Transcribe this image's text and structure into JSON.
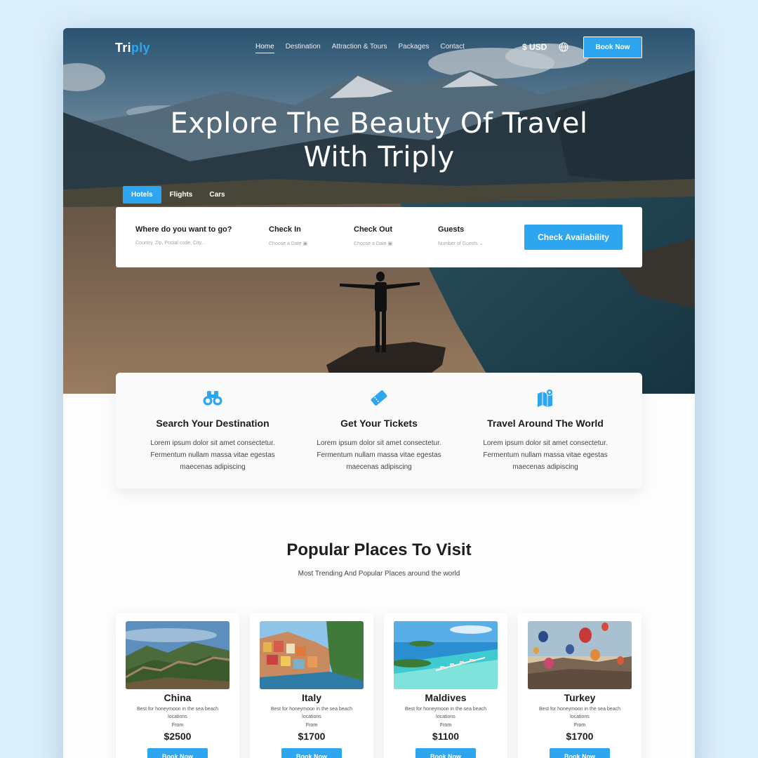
{
  "brand": {
    "logo_main": "Tri",
    "logo_accent": "ply",
    "accent_color": "#2ea6ef"
  },
  "nav": {
    "links": [
      "Home",
      "Destination",
      "Attraction & Tours",
      "Packages",
      "Contact"
    ],
    "currency": "$ USD",
    "book_now": "Book Now",
    "icons": {
      "language": "globe-icon"
    }
  },
  "hero": {
    "title_line1": "Explore The Beauty Of Travel",
    "title_line2": "With Triply"
  },
  "search": {
    "tabs": [
      "Hotels",
      "Flights",
      "Cars"
    ],
    "active_tab": "Hotels",
    "fields": [
      {
        "label": "Where do you want to go?",
        "placeholder": "Country, Zip, Postal code, City..."
      },
      {
        "label": "Check In",
        "placeholder": "Choose a Date",
        "icon": "calendar-icon"
      },
      {
        "label": "Check Out",
        "placeholder": "Choose a Date",
        "icon": "calendar-icon"
      },
      {
        "label": "Guests",
        "placeholder": "Number of Guests",
        "icon": "chevron-down-icon"
      }
    ],
    "button": "Check Availability"
  },
  "features": [
    {
      "icon": "binoculars-icon",
      "title": "Search Your Destination",
      "text": "Lorem ipsum dolor sit amet consectetur. Fermentum nullam massa vitae egestas maecenas adipiscing"
    },
    {
      "icon": "ticket-icon",
      "title": "Get Your Tickets",
      "text": "Lorem ipsum dolor sit amet consectetur. Fermentum nullam massa vitae egestas maecenas adipiscing"
    },
    {
      "icon": "map-pin-icon",
      "title": "Travel Around The World",
      "text": "Lorem ipsum dolor sit amet consectetur. Fermentum nullam massa vitae egestas maecenas adipiscing"
    }
  ],
  "popular": {
    "title": "Popular Places To Visit",
    "subtitle": "Most Trending And Popular Places around the world",
    "places": [
      {
        "name": "China",
        "desc": "Best for honeymoon in the sea beach locations",
        "from": "From",
        "price": "$2500",
        "button": "Book Now"
      },
      {
        "name": "Italy",
        "desc": "Best for honeymoon in the sea beach locations",
        "from": "From",
        "price": "$1700",
        "button": "Book Now"
      },
      {
        "name": "Maldives",
        "desc": "Best for honeymoon in the sea beach locations",
        "from": "From",
        "price": "$1100",
        "button": "Book Now"
      },
      {
        "name": "Turkey",
        "desc": "Best for honeymoon in the sea beach locations",
        "from": "From",
        "price": "$1700",
        "button": "Book Now"
      }
    ]
  }
}
